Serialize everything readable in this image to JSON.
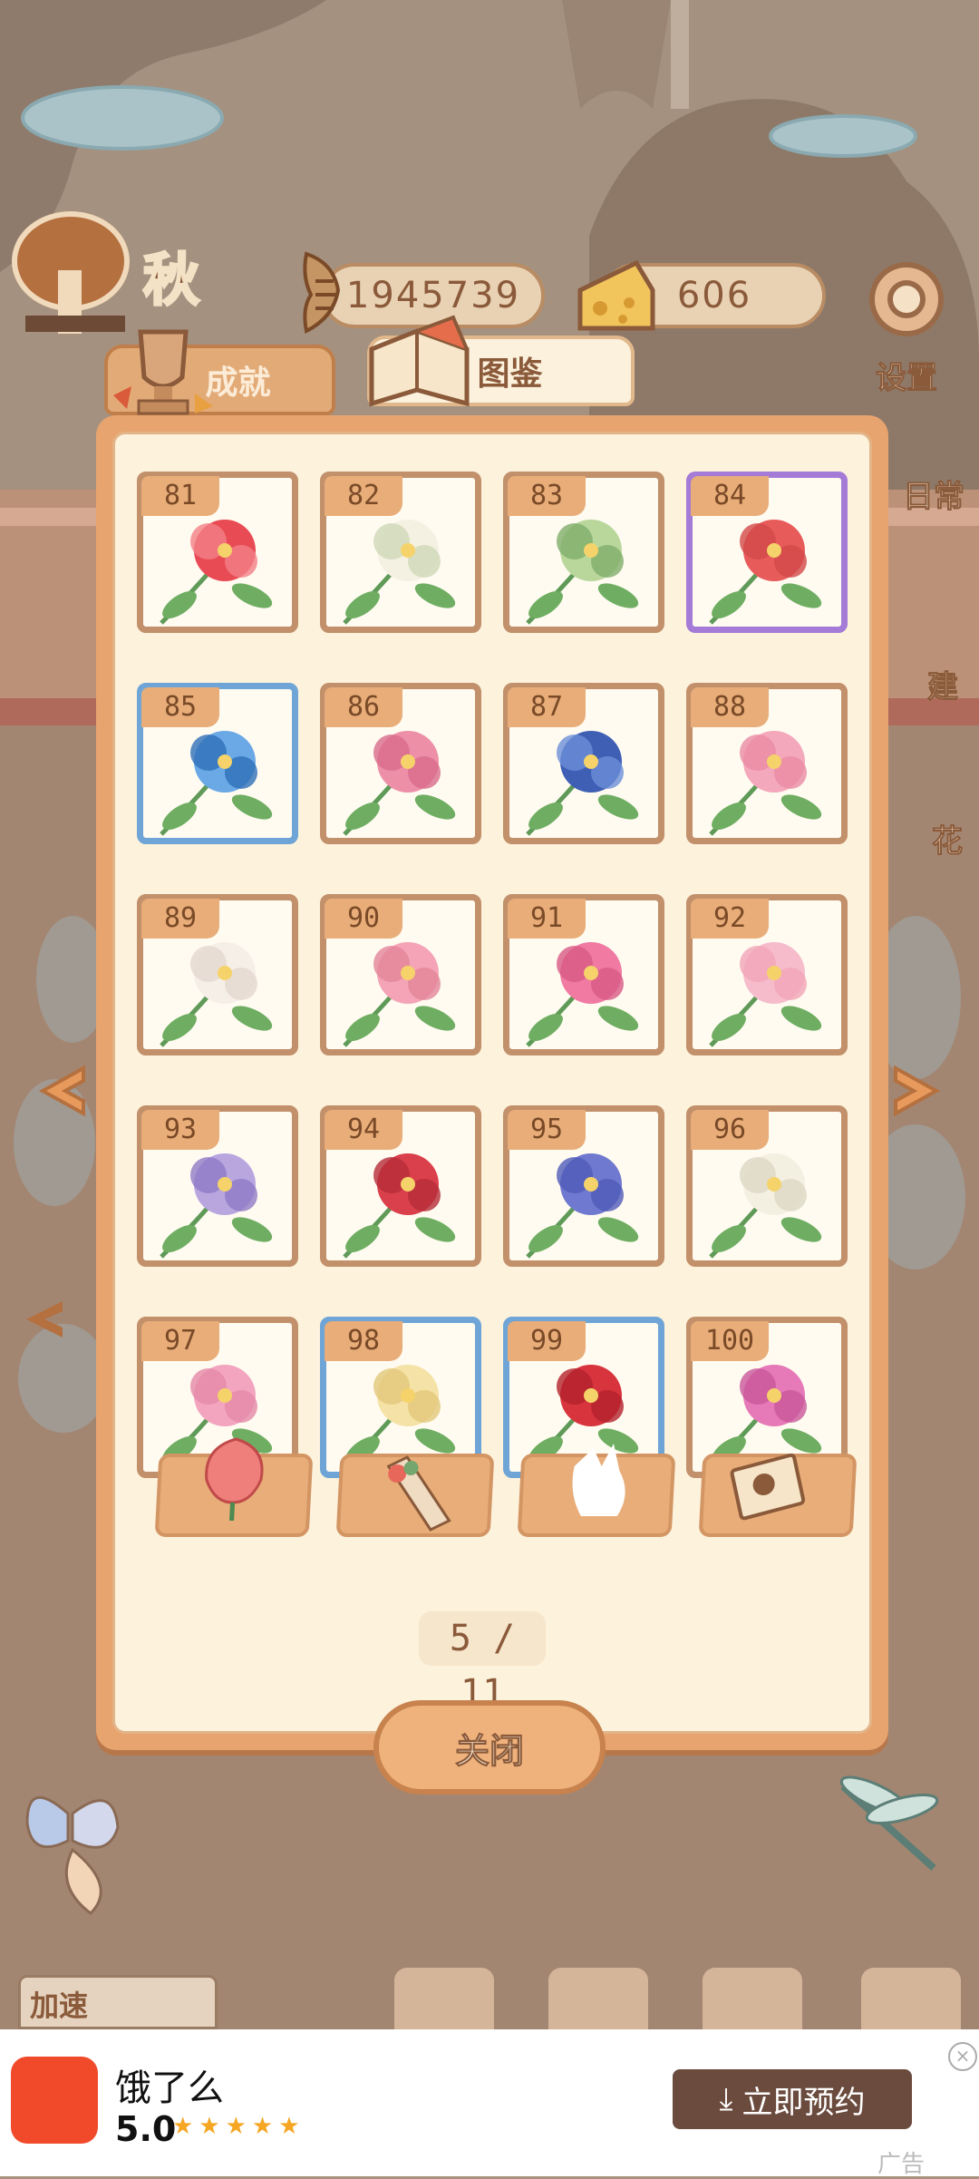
{
  "header": {
    "season": "秋",
    "fish_count": "1945739",
    "cheese_count": "606",
    "settings_label": "设置"
  },
  "side": {
    "daily_label": "日常",
    "build_label": "建",
    "flower_label": "花"
  },
  "tabs": [
    {
      "label": "成就"
    },
    {
      "label": "图鉴"
    }
  ],
  "flowers": [
    {
      "num": "81",
      "frame": "brown"
    },
    {
      "num": "82",
      "frame": "brown"
    },
    {
      "num": "83",
      "frame": "brown"
    },
    {
      "num": "84",
      "frame": "purple"
    },
    {
      "num": "85",
      "frame": "blue"
    },
    {
      "num": "86",
      "frame": "brown"
    },
    {
      "num": "87",
      "frame": "brown"
    },
    {
      "num": "88",
      "frame": "brown"
    },
    {
      "num": "89",
      "frame": "brown"
    },
    {
      "num": "90",
      "frame": "brown"
    },
    {
      "num": "91",
      "frame": "brown"
    },
    {
      "num": "92",
      "frame": "brown"
    },
    {
      "num": "93",
      "frame": "brown"
    },
    {
      "num": "94",
      "frame": "brown"
    },
    {
      "num": "95",
      "frame": "brown"
    },
    {
      "num": "96",
      "frame": "brown"
    },
    {
      "num": "97",
      "frame": "brown"
    },
    {
      "num": "98",
      "frame": "blue"
    },
    {
      "num": "99",
      "frame": "blue"
    },
    {
      "num": "100",
      "frame": "brown"
    }
  ],
  "page_indicator": "5 / 11",
  "close_label": "关闭",
  "bottom": {
    "speed_label": "加速"
  },
  "ad": {
    "app_name": "饿了么",
    "rating": "5.0",
    "stars": "★★★★★",
    "cta": "立即预约",
    "label": "广告"
  },
  "colors": {
    "accent": "#e8a46f",
    "panel": "#fdf2dc",
    "text_brown": "#8a5a3a"
  }
}
